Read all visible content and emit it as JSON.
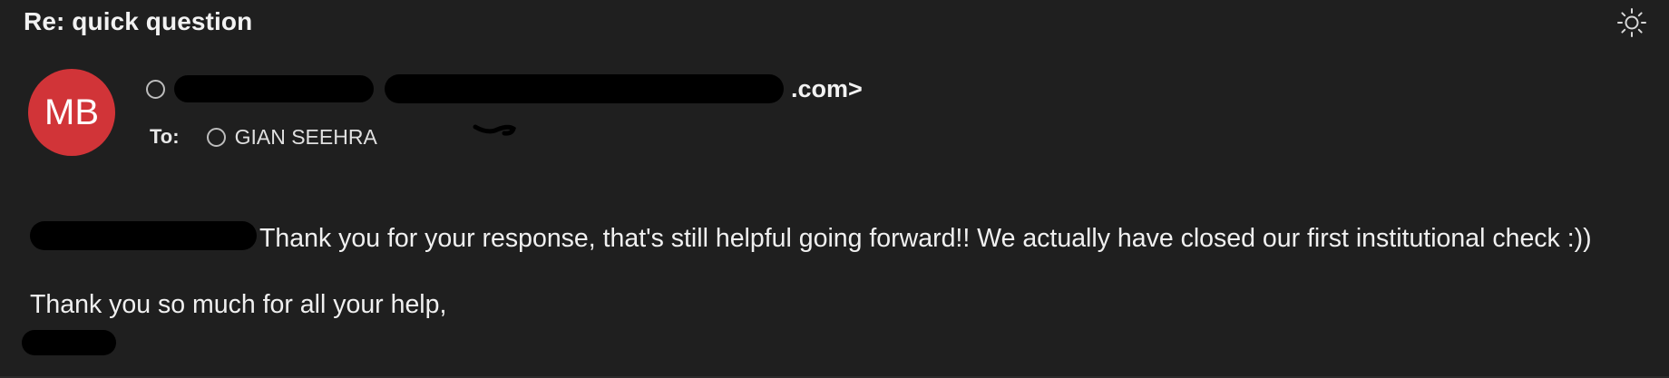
{
  "email": {
    "subject": "Re: quick question",
    "sender": {
      "avatar_initials": "MB",
      "avatar_color": "#d13438",
      "address_visible_tail": ".com>"
    },
    "to": {
      "label": "To:",
      "name": "GIAN SEEHRA"
    },
    "body": {
      "line1": "Thank you for your response, that's still helpful going forward!! We actually have closed our first institutional check :))",
      "line2": "Thank you so much for all your help,"
    }
  },
  "icons": {
    "theme_toggle": "sun-icon",
    "presence": "presence-circle-icon"
  },
  "colors": {
    "background": "#1f1f1f",
    "text": "#f0f0f0",
    "redaction": "#000000"
  }
}
